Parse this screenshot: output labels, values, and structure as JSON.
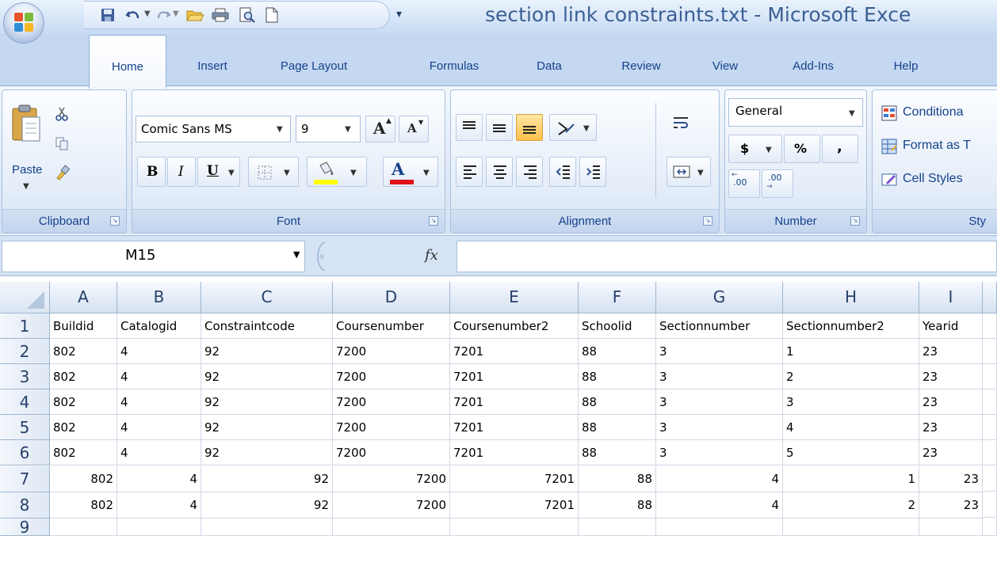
{
  "window": {
    "title": "section link constraints.txt - Microsoft Exce"
  },
  "tabs": [
    {
      "label": "Home",
      "active": true
    },
    {
      "label": "Insert",
      "active": false
    },
    {
      "label": "Page Layout",
      "active": false
    },
    {
      "label": "Formulas",
      "active": false
    },
    {
      "label": "Data",
      "active": false
    },
    {
      "label": "Review",
      "active": false
    },
    {
      "label": "View",
      "active": false
    },
    {
      "label": "Add-Ins",
      "active": false
    },
    {
      "label": "Help",
      "active": false
    }
  ],
  "ribbon": {
    "clipboard": {
      "label": "Clipboard",
      "paste_label": "Paste"
    },
    "font": {
      "label": "Font",
      "font_name": "Comic Sans MS",
      "font_size": "9",
      "bold": "B",
      "italic": "I",
      "underline": "U",
      "grow": "A",
      "shrink": "A",
      "font_color_letter": "A"
    },
    "alignment": {
      "label": "Alignment"
    },
    "number": {
      "label": "Number",
      "format": "General",
      "currency": "$",
      "percent": "%",
      "comma": ",",
      "inc_decimal": ".00",
      "dec_decimal": ".00"
    },
    "styles": {
      "label": "Sty",
      "conditional": "Conditiona",
      "format_as_table": "Format as T",
      "cell_styles": "Cell Styles"
    }
  },
  "formula_bar": {
    "name_box": "M15",
    "fx": "fx",
    "formula": ""
  },
  "sheet": {
    "columns": [
      "A",
      "B",
      "C",
      "D",
      "E",
      "F",
      "G",
      "H",
      "I"
    ],
    "row_numbers": [
      "1",
      "2",
      "3",
      "4",
      "5",
      "6",
      "7",
      "8",
      "9"
    ],
    "rows": [
      [
        "Buildid",
        "Catalogid",
        "Constraintcode",
        "Coursenumber",
        "Coursenumber2",
        "Schoolid",
        "Sectionnumber",
        "Sectionnumber2",
        "Yearid"
      ],
      [
        "802",
        "4",
        "92",
        "7200",
        "7201",
        "88",
        "3",
        "1",
        "23"
      ],
      [
        "802",
        "4",
        "92",
        "7200",
        "7201",
        "88",
        "3",
        "2",
        "23"
      ],
      [
        "802",
        "4",
        "92",
        "7200",
        "7201",
        "88",
        "3",
        "3",
        "23"
      ],
      [
        "802",
        "4",
        "92",
        "7200",
        "7201",
        "88",
        "3",
        "4",
        "23"
      ],
      [
        "802",
        "4",
        "92",
        "7200",
        "7201",
        "88",
        "3",
        "5",
        "23"
      ],
      [
        "802",
        "4",
        "92",
        "7200",
        "7201",
        "88",
        "4",
        "1",
        "23"
      ],
      [
        "802",
        "4",
        "92",
        "7200",
        "7201",
        "88",
        "4",
        "2",
        "23"
      ],
      [
        "",
        "",
        "",
        "",
        "",
        "",
        "",
        "",
        ""
      ]
    ],
    "right_aligned_rows": [
      7,
      8
    ]
  }
}
